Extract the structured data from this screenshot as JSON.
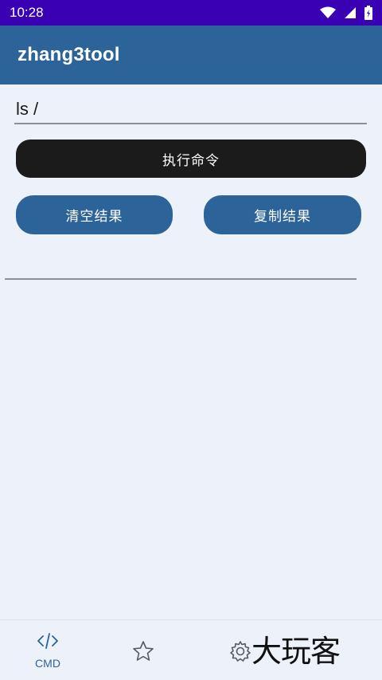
{
  "status_bar": {
    "time": "10:28",
    "icons": [
      "wifi-icon",
      "signal-icon",
      "battery-icon"
    ]
  },
  "app_bar": {
    "title": "zhang3tool"
  },
  "command": {
    "value": "ls /"
  },
  "buttons": {
    "execute": "执行命令",
    "clear": "清空结果",
    "copy": "复制结果"
  },
  "bottom_nav": {
    "items": [
      {
        "icon": "code-icon",
        "label": "CMD",
        "active": true
      },
      {
        "icon": "star-icon"
      },
      {
        "icon": "gear-icon"
      }
    ]
  },
  "watermark": {
    "text": "大玩客"
  },
  "colors": {
    "status_bar": "#3a00b4",
    "primary": "#2c6499",
    "execute_button": "#1b1b1b",
    "background": "#edf1fa"
  }
}
